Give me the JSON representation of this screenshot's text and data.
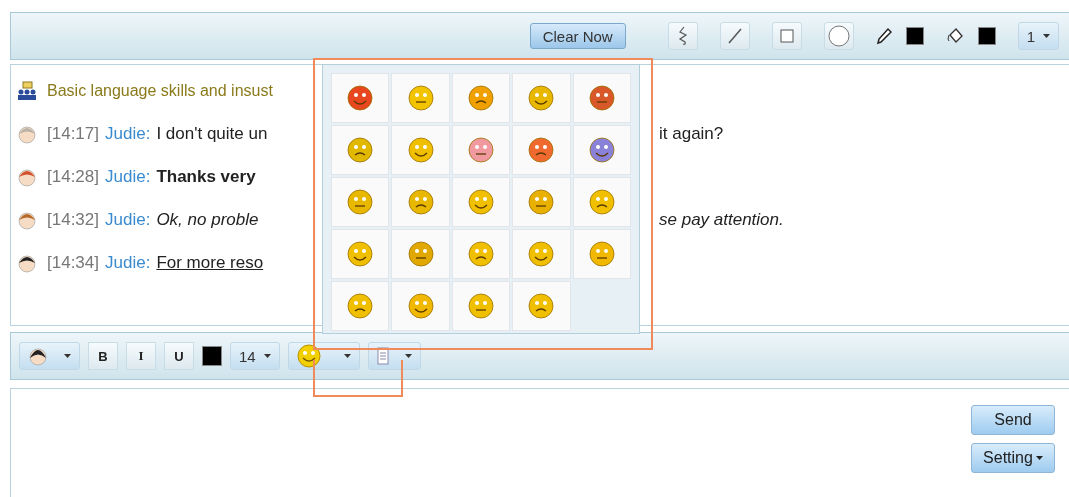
{
  "drawing_toolbar": {
    "clear_button": "Clear Now",
    "tools": [
      {
        "kind": "squiggle",
        "selected": false
      },
      {
        "kind": "line",
        "selected": false
      },
      {
        "kind": "rectangle",
        "selected": false
      },
      {
        "kind": "ellipse",
        "selected": false
      }
    ],
    "size_dropdown": "1"
  },
  "messages": [
    {
      "kind": "system",
      "text_before": "Basic language skills and insust"
    },
    {
      "kind": "plain",
      "time": "[14:17]",
      "sender": "Judie:",
      "text_before": "I don't quite un",
      "text_after": "it again?"
    },
    {
      "kind": "bold",
      "time": "[14:28]",
      "sender": "Judie:",
      "text_before": "Thanks very"
    },
    {
      "kind": "italic",
      "time": "[14:32]",
      "sender": "Judie:",
      "text_before": "Ok, no proble",
      "text_after": "se pay attention."
    },
    {
      "kind": "underline",
      "time": "[14:34]",
      "sender": "Judie:",
      "text_before": "For more reso"
    }
  ],
  "emoji_picker": {
    "open": true
  },
  "format_toolbar": {
    "bold": "B",
    "italic": "I",
    "underline": "U",
    "font_size": "14"
  },
  "send_button": "Send",
  "setting_button": "Setting"
}
